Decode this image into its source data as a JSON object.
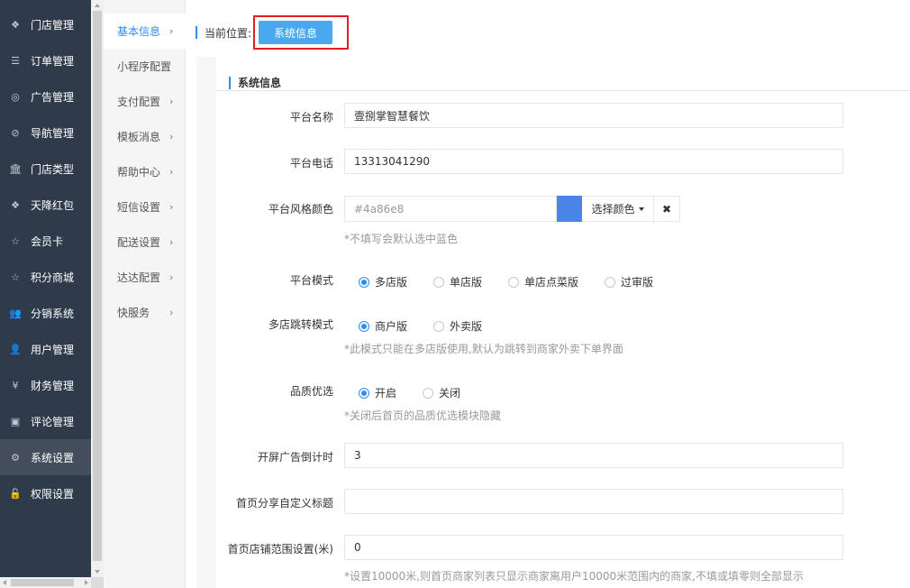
{
  "sidebar": {
    "items": [
      {
        "label": "门店管理",
        "icon": "cubes-icon",
        "glyph": "❖"
      },
      {
        "label": "订单管理",
        "icon": "list-icon",
        "glyph": "☰"
      },
      {
        "label": "广告管理",
        "icon": "lifebuoy-icon",
        "glyph": "◎"
      },
      {
        "label": "导航管理",
        "icon": "compass-icon",
        "glyph": "⊘"
      },
      {
        "label": "门店类型",
        "icon": "bank-icon",
        "glyph": "🏛"
      },
      {
        "label": "天降红包",
        "icon": "cubes-icon",
        "glyph": "❖"
      },
      {
        "label": "会员卡",
        "icon": "star-icon",
        "glyph": "☆"
      },
      {
        "label": "积分商城",
        "icon": "star-icon",
        "glyph": "☆"
      },
      {
        "label": "分销系统",
        "icon": "users-icon",
        "glyph": "👥"
      },
      {
        "label": "用户管理",
        "icon": "user-icon",
        "glyph": "👤"
      },
      {
        "label": "财务管理",
        "icon": "yen-icon",
        "glyph": "¥"
      },
      {
        "label": "评论管理",
        "icon": "money-icon",
        "glyph": "▣"
      },
      {
        "label": "系统设置",
        "icon": "gear-icon",
        "glyph": "⚙"
      },
      {
        "label": "权限设置",
        "icon": "lock-icon",
        "glyph": "🔓"
      }
    ],
    "active_index": 12
  },
  "submenu": {
    "items": [
      {
        "label": "基本信息",
        "chevron": "›"
      },
      {
        "label": "小程序配置",
        "chevron": ""
      },
      {
        "label": "支付配置",
        "chevron": "›"
      },
      {
        "label": "模板消息",
        "chevron": "›"
      },
      {
        "label": "帮助中心",
        "chevron": "›"
      },
      {
        "label": "短信设置",
        "chevron": "›"
      },
      {
        "label": "配送设置",
        "chevron": "›"
      },
      {
        "label": "达达配置",
        "chevron": "›"
      },
      {
        "label": "快服务",
        "chevron": "›"
      }
    ],
    "active_index": 0
  },
  "breadcrumb": {
    "label": "当前位置:",
    "current": "系统信息"
  },
  "section": {
    "title": "系统信息"
  },
  "form": {
    "platform_name": {
      "label": "平台名称",
      "value": "壹捌掌智慧餐饮"
    },
    "platform_phone": {
      "label": "平台电话",
      "value": "13313041290"
    },
    "platform_color": {
      "label": "平台风格颜色",
      "value": "#4a86e8",
      "swatch": "#4a86e8",
      "pick_label": "选择颜色",
      "clear_label": "✖",
      "hint": "*不填写会默认选中蓝色"
    },
    "platform_mode": {
      "label": "平台模式",
      "options": [
        "多店版",
        "单店版",
        "单店点菜版",
        "过审版"
      ],
      "selected": 0
    },
    "jump_mode": {
      "label": "多店跳转模式",
      "options": [
        "商户版",
        "外卖版"
      ],
      "selected": 0,
      "hint": "*此模式只能在多店版使用,默认为跳转到商家外卖下单界面"
    },
    "quality": {
      "label": "品质优选",
      "options": [
        "开启",
        "关闭"
      ],
      "selected": 0,
      "hint": "*关闭后首页的品质优选模块隐藏"
    },
    "splash_countdown": {
      "label": "开屏广告倒计时",
      "value": "3"
    },
    "share_title": {
      "label": "首页分享自定义标题",
      "value": ""
    },
    "store_range": {
      "label": "首页店铺范围设置(米)",
      "value": "0",
      "hint": "*设置10000米,则首页商家列表只显示商家离用户10000米范围内的商家,不填或填零则全部显示"
    }
  },
  "colors": {
    "sidebar_bg": "#2f3b4b",
    "accent": "#2d8cf0",
    "breadcrumb_btn": "#4aa9ee",
    "highlight_border": "#e02020"
  }
}
